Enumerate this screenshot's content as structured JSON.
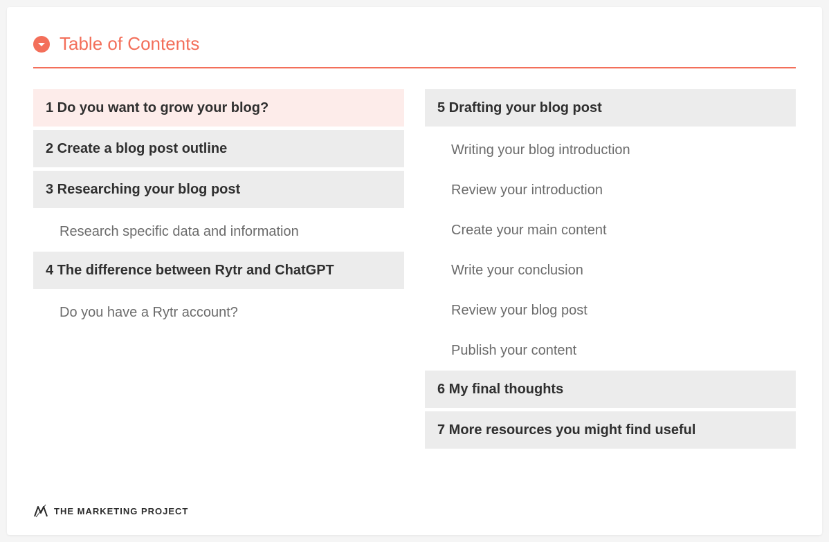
{
  "header": {
    "title": "Table of Contents"
  },
  "columns": {
    "left": [
      {
        "type": "main",
        "num": "1",
        "label": "Do you want to grow your blog?",
        "active": true
      },
      {
        "type": "main",
        "num": "2",
        "label": "Create a blog post outline"
      },
      {
        "type": "main",
        "num": "3",
        "label": "Researching your blog post"
      },
      {
        "type": "sub",
        "label": "Research specific data and information"
      },
      {
        "type": "main",
        "num": "4",
        "label": "The difference between Rytr and ChatGPT"
      },
      {
        "type": "sub",
        "label": "Do you have a Rytr account?"
      }
    ],
    "right": [
      {
        "type": "main",
        "num": "5",
        "label": "Drafting your blog post"
      },
      {
        "type": "sub",
        "label": "Writing your blog introduction"
      },
      {
        "type": "sub",
        "label": "Review your introduction"
      },
      {
        "type": "sub",
        "label": "Create your main content"
      },
      {
        "type": "sub",
        "label": "Write your conclusion"
      },
      {
        "type": "sub",
        "label": "Review your blog post"
      },
      {
        "type": "sub",
        "label": "Publish your content"
      },
      {
        "type": "main",
        "num": "6",
        "label": "My final thoughts"
      },
      {
        "type": "main",
        "num": "7",
        "label": "More resources you might find useful"
      }
    ]
  },
  "logo": {
    "text": "THE MARKETING PROJECT"
  },
  "colors": {
    "accent": "#f36f5a",
    "mainBg": "#ececec",
    "activeBg": "#fdecea"
  }
}
